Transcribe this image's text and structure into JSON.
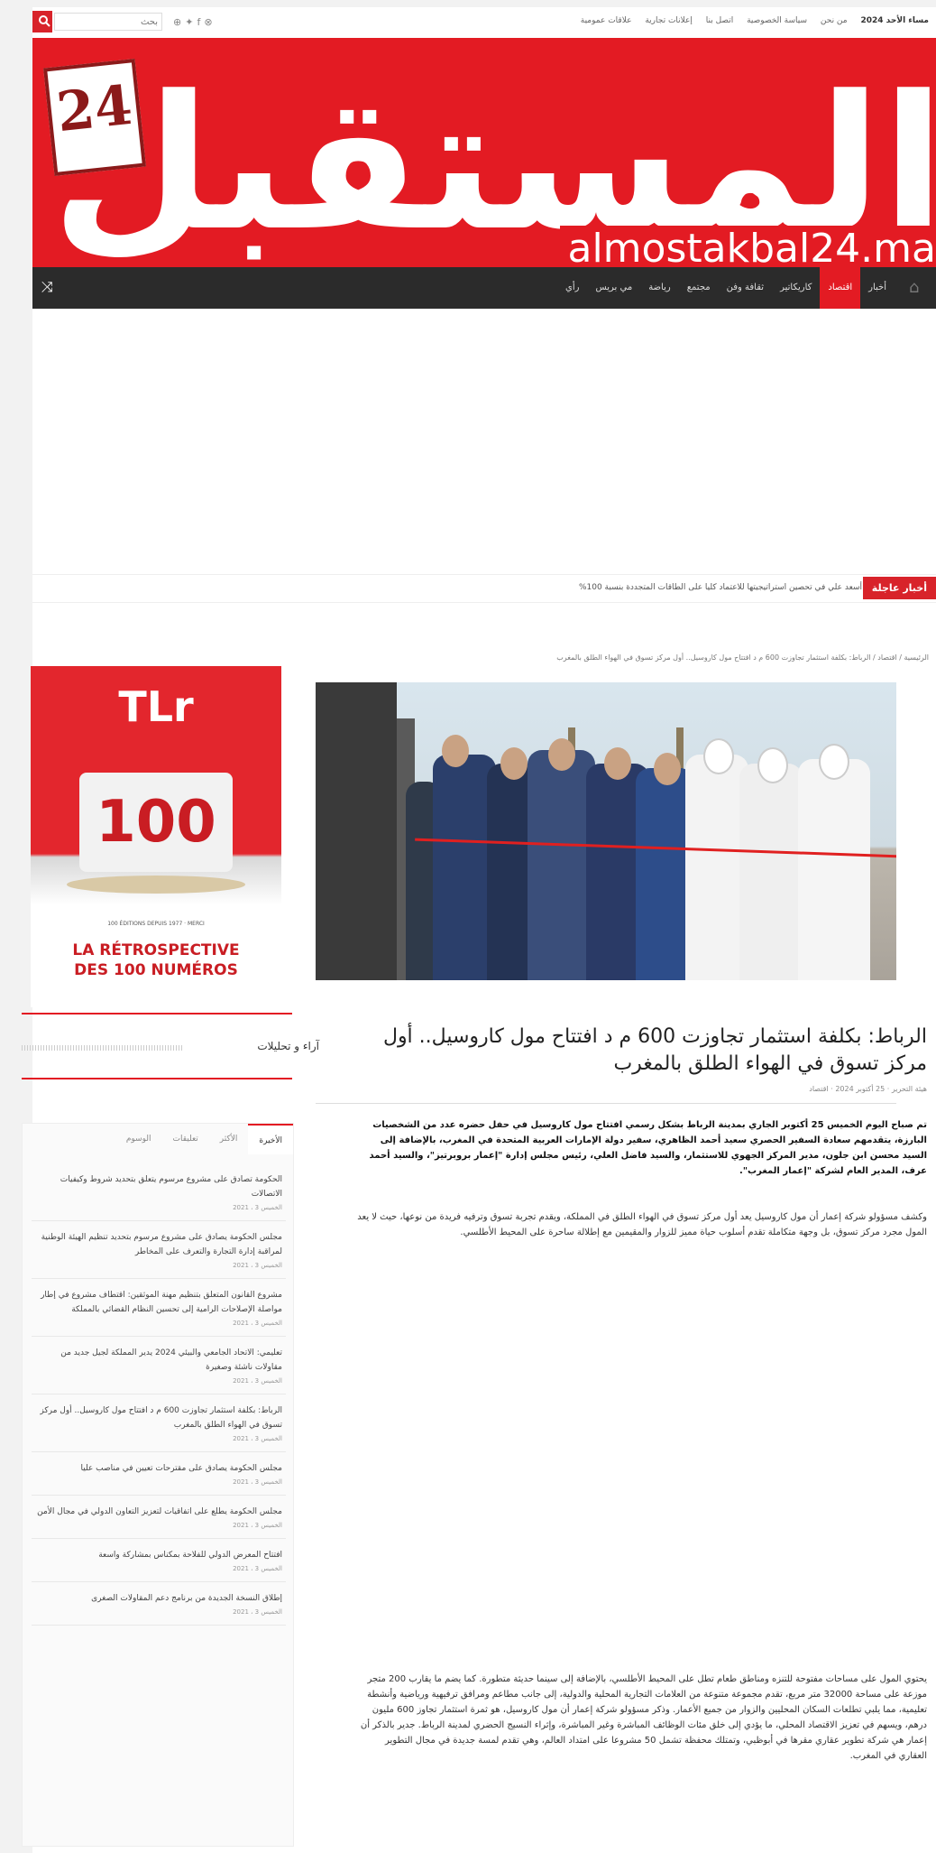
{
  "topbar": {
    "search_placeholder": "بحث",
    "social_icons": [
      "rss-icon",
      "twitter-icon",
      "facebook-icon",
      "home-icon"
    ],
    "links": [
      "مساء الأحد 2024",
      "من نحن",
      "سياسة الخصوصية",
      "اتصل بنا",
      "إعلانات تجارية",
      "علاقات عمومية"
    ]
  },
  "header": {
    "logo_word": "المستقبل",
    "logo_number": "24",
    "logo_url": "almostakbal24.ma",
    "brand_color": "#e31b23"
  },
  "nav": {
    "items": [
      "أخبار",
      "اقتصاد",
      "كاريكاتير",
      "ثقافة وفن",
      "مجتمع",
      "رياضة",
      "مي بريس",
      "رأي"
    ],
    "active_index": 1
  },
  "ticker": {
    "label": "أخبار عاجلة",
    "text": "أسعد علي في تحصين استراتيجيتها للاعتماد كليا على الطاقات المتجددة بنسبة 100%"
  },
  "breadcrumb": "الرئيسية / اقتصاد / الرباط: بكلفة استثمار تجاوزت 600 م د افتتاح مول كاروسيل.. أول مركز تسوق في الهواء الطلق بالمغرب",
  "article": {
    "title": "الرباط: بكلفة استثمار تجاوزت 600 م د افتتاح مول كاروسيل.. أول مركز تسوق في الهواء الطلق بالمغرب",
    "meta": "هيئة التحرير · 25 أكتوبر 2024 · اقتصاد",
    "p1": "تم صباح اليوم الخميس 25 أكتوبر الجاري بمدينة الرباط بشكل رسمي افتتاح مول كاروسيل في حفل حضره عدد من الشخصيات البارزة، يتقدمهم سعادة السفير الحصري سعيد أحمد الظاهري، سفير دولة الإمارات العربية المتحدة في المغرب، بالإضافة إلى السيد محسن ابن جلون، مدير المركز الجهوي للاستثمار، والسيد فاضل العلي، رئيس مجلس إدارة \"إعمار بروبرتيز\"، والسيد أحمد عرف، المدير العام لشركة \"إعمار المغرب\".",
    "p2": "وكشف مسؤولو شركة إعمار أن مول كاروسيل يعد أول مركز تسوق في الهواء الطلق في المملكة، ويقدم تجربة تسوق وترفيه فريدة من نوعها، حيث لا يعد المول مجرد مركز تسوق، بل وجهة متكاملة تقدم أسلوب حياة مميز للزوار والمقيمين مع إطلالة ساحرة على المحيط الأطلسي.",
    "p3": "يحتوي المول على مساحات مفتوحة للتنزه ومناطق طعام تطل على المحيط الأطلسي، بالإضافة إلى سينما حديثة متطورة. كما يضم ما يقارب 200 متجر موزعة على مساحة 32000 متر مربع، تقدم مجموعة متنوعة من العلامات التجارية المحلية والدولية، إلى جانب مطاعم ومرافق ترفيهية ورياضية وأنشطة تعليمية، مما يلبي تطلعات السكان المحليين والزوار من جميع الأعمار. وذكر مسؤولو شركة إعمار أن مول كاروسيل، هو ثمرة استثمار تجاوز 600 مليون درهم، ويسهم في تعزيز الاقتصاد المحلي، ما يؤدي إلى خلق مئات الوظائف المباشرة وغير المباشرة، وإثراء النسيج الحضري لمدينة الرباط. جدير بالذكر أن إعمار هي شركة تطوير عقاري مقرها في أبوظبي، وتمتلك محفظة تشمل 50 مشروعا على امتداد العالم، وهي تقدم لمسة جديدة في مجال التطوير العقاري في المغرب."
  },
  "sidebar": {
    "ad": {
      "brand": "TLr",
      "number": "100",
      "small": "100 ÉDITIONS DEPUIS 1977 · MERCI",
      "headline_1": "LA RÉTROSPECTIVE",
      "headline_2": "DES 100 NUMÉROS"
    },
    "widget_title": "آراء و تحليلات",
    "tabs": [
      "الأخيرة",
      "الأكثر",
      "تعليقات",
      "الوسوم"
    ],
    "items": [
      {
        "title": "الحكومة تصادق على مشروع مرسوم يتعلق بتحديد شروط وكيفيات الاتصالات",
        "date": "الخميس 3 ، 2021"
      },
      {
        "title": "مجلس الحكومة يصادق على مشروع مرسوم بتحديد تنظيم الهيئة الوطنية لمراقبة إدارة التجارة والتعرف على المخاطر",
        "date": "الخميس 3 ، 2021"
      },
      {
        "title": "مشروع القانون المتعلق بتنظيم مهنة الموثقين: اقتطاف مشروع في إطار مواصلة الإصلاحات الرامية إلى تحسين النظام القضائي بالمملكة",
        "date": "الخميس 3 ، 2021"
      },
      {
        "title": "تعليمي: الاتحاد الجامعي والبيئي 2024 يدير المملكة لجيل جديد من مقاولات ناشئة وصغيرة",
        "date": "الخميس 3 ، 2021"
      },
      {
        "title": "الرباط: بكلفة استثمار تجاوزت 600 م د افتتاح مول كاروسيل.. أول مركز تسوق في الهواء الطلق بالمغرب",
        "date": "الخميس 3 ، 2021"
      },
      {
        "title": "مجلس الحكومة يصادق على مقترحات تعيين في مناصب عليا",
        "date": "الخميس 3 ، 2021"
      },
      {
        "title": "مجلس الحكومة يطلع على اتفاقيات لتعزيز التعاون الدولي في مجال الأمن",
        "date": "الخميس 3 ، 2021"
      },
      {
        "title": "افتتاح المعرض الدولي للفلاحة بمكناس بمشاركة واسعة",
        "date": "الخميس 3 ، 2021"
      },
      {
        "title": "إطلاق النسخة الجديدة من برنامج دعم المقاولات الصغرى",
        "date": "الخميس 3 ، 2021"
      }
    ]
  }
}
